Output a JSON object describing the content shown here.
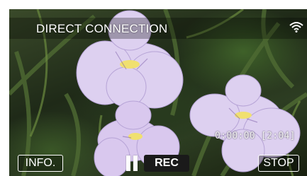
{
  "header": {
    "title": "DIRECT CONNECTION",
    "wifi_icon": "wifi-icon"
  },
  "status": {
    "elapsed_time": "0:00:00",
    "remaining_time": "[2:04]"
  },
  "controls": {
    "info_label": "INFO.",
    "pause_icon": "pause-icon",
    "rec_label": "REC",
    "stop_label": "STOP"
  },
  "colors": {
    "overlay_text": "#ffffff",
    "rec_button_bg": "#1a1a1a",
    "flower": "#d9c8ee",
    "foliage": "#3a4a2a"
  }
}
